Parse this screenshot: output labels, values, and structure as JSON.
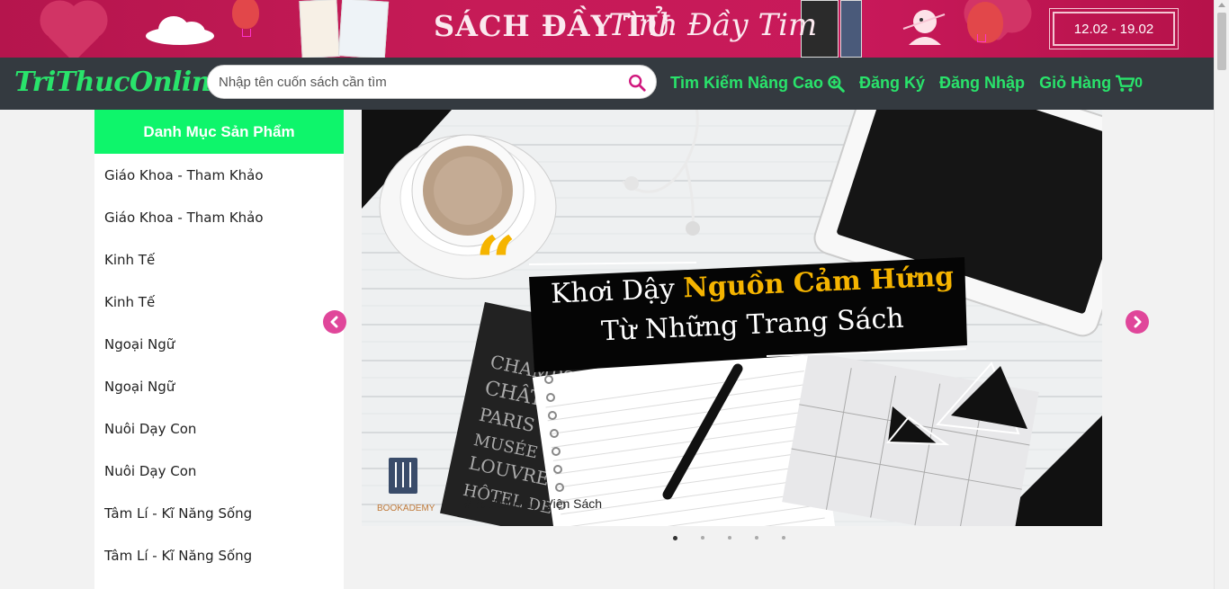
{
  "promo": {
    "title": "SÁCH ĐẦY TỦ",
    "script": "Tình Đầy Tim",
    "date": "12.02 - 19.02"
  },
  "nav": {
    "logo": "TriThucOnline",
    "search_placeholder": "Nhập tên cuốn sách cần tìm",
    "links": {
      "advanced_search": "Tìm Kiếm Nâng Cao",
      "register": "Đăng Ký",
      "login": "Đăng Nhập",
      "cart": "Giỏ Hàng",
      "cart_count": "0"
    }
  },
  "sidebar": {
    "title": "Danh Mục Sản Phẩm",
    "items": [
      {
        "label": "Giáo Khoa - Tham Khảo"
      },
      {
        "label": "Giáo Khoa - Tham Khảo"
      },
      {
        "label": "Kinh Tế"
      },
      {
        "label": "Kinh Tế"
      },
      {
        "label": "Ngoại Ngữ"
      },
      {
        "label": "Ngoại Ngữ"
      },
      {
        "label": "Nuôi Dạy Con"
      },
      {
        "label": "Nuôi Dạy Con"
      },
      {
        "label": "Tâm Lí - Kĩ Năng Sống"
      },
      {
        "label": "Tâm Lí - Kĩ Năng Sống"
      }
    ]
  },
  "carousel": {
    "slide": {
      "line1_prefix": "Khơi Dậy",
      "line1_highlight": "Nguồn Cảm Hứng",
      "line2": "Từ Những Trang Sách",
      "brand": "BOOKADEMY",
      "hashtag": "#Bookademy_Viện Sách",
      "notebook_text": "CHAMPS CHÂTEAU PARIS MUSÉE LOUVRE HÔTEL DE"
    },
    "active_index": 0,
    "slide_count": 5
  },
  "colors": {
    "accent_green": "#29e36b",
    "header_bg": "#343a40",
    "promo_bg": "#c61b57",
    "carousel_control": "#e0469a"
  }
}
